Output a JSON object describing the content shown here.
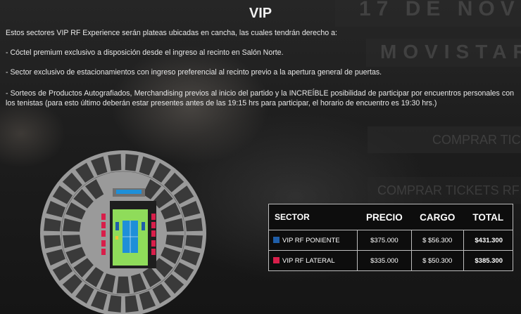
{
  "page": {
    "title": "VIP",
    "intro": "Estos sectores VIP RF Experience serán plateas ubicadas en cancha, las cuales tendrán derecho a:",
    "benefits": [
      "- Cóctel premium exclusivo a disposición desde el ingreso al recinto en Salón Norte.",
      "- Sector exclusivo de estacionamientos con ingreso preferencial al recinto previo a la apertura general de puertas.",
      "- Sorteos de Productos Autografiados, Merchandising previos al inicio del partido y la INCREÍBLE posibilidad de participar por encuentros personales con los tenistas (para esto último deberán estar presentes antes de las 19:15 hrs para participar, el horario de encuentro es 19:30 hrs.)"
    ]
  },
  "background": {
    "date_text": "17 DE NOVI",
    "venue_text": "MOVISTAR",
    "buy_button_1": "COMPRAR TIC",
    "buy_button_2": "COMPRAR TICKETS RF"
  },
  "prices": {
    "headers": {
      "sector": "SECTOR",
      "precio": "PRECIO",
      "cargo": "CARGO",
      "total": "TOTAL"
    },
    "rows": [
      {
        "sector": "VIP RF PONIENTE",
        "precio": "$375.000",
        "cargo": "$  $56.300",
        "total": "$431.300",
        "color": "#1f5ea8"
      },
      {
        "sector": "VIP RF LATERAL",
        "precio": "$335.000",
        "cargo": "$  $50.300",
        "total": "$385.300",
        "color": "#d81e4a"
      }
    ]
  },
  "colors": {
    "stadium_grey": "#9a9a9a",
    "block_dark": "#3a3a3a",
    "court_green": "#8fdc5a",
    "court_blue": "#1e8fd8",
    "vip_poniente": "#1f5ea8",
    "vip_lateral": "#d81e4a"
  }
}
